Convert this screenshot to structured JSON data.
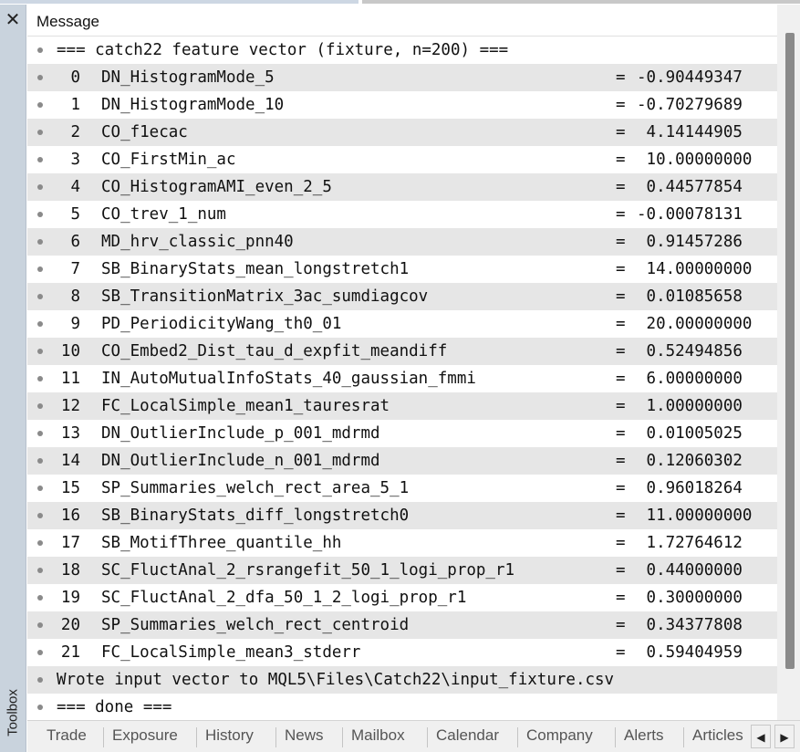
{
  "panel": {
    "close_icon": "✕",
    "side_label": "Toolbox",
    "column_header": "Message"
  },
  "log": {
    "header_line": "=== catch22 feature vector (fixture, n=200) ===",
    "features": [
      {
        "index": "0",
        "name": "DN_HistogramMode_5",
        "eq": "=",
        "value": "-0.90449347"
      },
      {
        "index": "1",
        "name": "DN_HistogramMode_10",
        "eq": "=",
        "value": "-0.70279689"
      },
      {
        "index": "2",
        "name": "CO_f1ecac",
        "eq": "=",
        "value": " 4.14144905"
      },
      {
        "index": "3",
        "name": "CO_FirstMin_ac",
        "eq": "=",
        "value": " 10.00000000"
      },
      {
        "index": "4",
        "name": "CO_HistogramAMI_even_2_5",
        "eq": "=",
        "value": " 0.44577854"
      },
      {
        "index": "5",
        "name": "CO_trev_1_num",
        "eq": "=",
        "value": "-0.00078131"
      },
      {
        "index": "6",
        "name": "MD_hrv_classic_pnn40",
        "eq": "=",
        "value": " 0.91457286"
      },
      {
        "index": "7",
        "name": "SB_BinaryStats_mean_longstretch1",
        "eq": "=",
        "value": " 14.00000000"
      },
      {
        "index": "8",
        "name": "SB_TransitionMatrix_3ac_sumdiagcov",
        "eq": "=",
        "value": " 0.01085658"
      },
      {
        "index": "9",
        "name": "PD_PeriodicityWang_th0_01",
        "eq": "=",
        "value": " 20.00000000"
      },
      {
        "index": "10",
        "name": "CO_Embed2_Dist_tau_d_expfit_meandiff",
        "eq": "=",
        "value": " 0.52494856"
      },
      {
        "index": "11",
        "name": "IN_AutoMutualInfoStats_40_gaussian_fmmi",
        "eq": "=",
        "value": " 6.00000000"
      },
      {
        "index": "12",
        "name": "FC_LocalSimple_mean1_tauresrat",
        "eq": "=",
        "value": " 1.00000000"
      },
      {
        "index": "13",
        "name": "DN_OutlierInclude_p_001_mdrmd",
        "eq": "=",
        "value": " 0.01005025"
      },
      {
        "index": "14",
        "name": "DN_OutlierInclude_n_001_mdrmd",
        "eq": "=",
        "value": " 0.12060302"
      },
      {
        "index": "15",
        "name": "SP_Summaries_welch_rect_area_5_1",
        "eq": "=",
        "value": " 0.96018264"
      },
      {
        "index": "16",
        "name": "SB_BinaryStats_diff_longstretch0",
        "eq": "=",
        "value": " 11.00000000"
      },
      {
        "index": "17",
        "name": "SB_MotifThree_quantile_hh",
        "eq": "=",
        "value": " 1.72764612"
      },
      {
        "index": "18",
        "name": "SC_FluctAnal_2_rsrangefit_50_1_logi_prop_r1",
        "eq": "=",
        "value": " 0.44000000"
      },
      {
        "index": "19",
        "name": "SC_FluctAnal_2_dfa_50_1_2_logi_prop_r1",
        "eq": "=",
        "value": " 0.30000000"
      },
      {
        "index": "20",
        "name": "SP_Summaries_welch_rect_centroid",
        "eq": "=",
        "value": " 0.34377808"
      },
      {
        "index": "21",
        "name": "FC_LocalSimple_mean3_stderr",
        "eq": "=",
        "value": " 0.59404959"
      }
    ],
    "wrote_line": "Wrote input vector to MQL5\\Files\\Catch22\\input_fixture.csv",
    "done_line": "=== done ==="
  },
  "tabs": [
    "Trade",
    "Exposure",
    "History",
    "News",
    "Mailbox",
    "Calendar",
    "Company",
    "Alerts",
    "Articles"
  ],
  "tab_scroll": {
    "left_icon": "◀",
    "right_icon": "▶"
  }
}
